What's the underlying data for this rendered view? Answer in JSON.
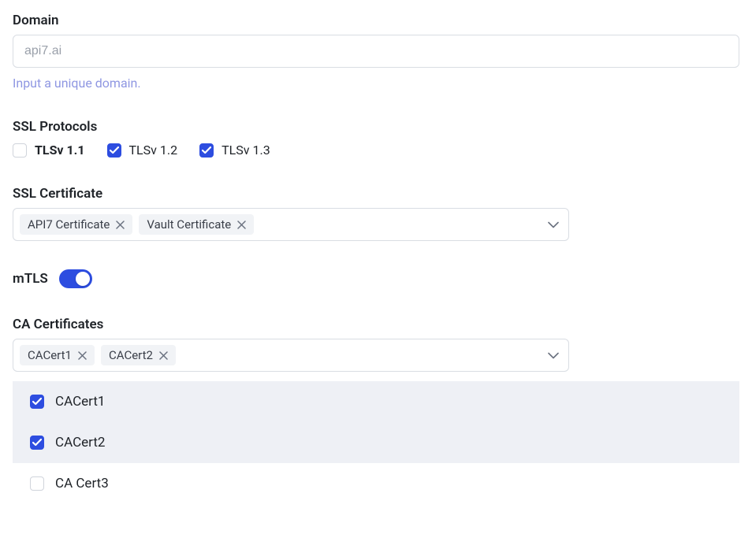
{
  "domain": {
    "label": "Domain",
    "placeholder": "api7.ai",
    "value": "",
    "helper": "Input a unique domain."
  },
  "ssl_protocols": {
    "label": "SSL Protocols",
    "options": [
      {
        "label": "TLSv 1.1",
        "checked": false,
        "bold": true
      },
      {
        "label": "TLSv 1.2",
        "checked": true,
        "bold": false
      },
      {
        "label": "TLSv 1.3",
        "checked": true,
        "bold": false
      }
    ]
  },
  "ssl_certificate": {
    "label": "SSL Certificate",
    "tags": [
      {
        "label": "API7 Certificate"
      },
      {
        "label": "Vault Certificate"
      }
    ]
  },
  "mtls": {
    "label": "mTLS",
    "enabled": true
  },
  "ca_certificates": {
    "label": "CA Certificates",
    "tags": [
      {
        "label": "CACert1"
      },
      {
        "label": "CACert2"
      }
    ],
    "options": [
      {
        "label": "CACert1",
        "checked": true
      },
      {
        "label": "CACert2",
        "checked": true
      },
      {
        "label": "CA Cert3",
        "checked": false
      }
    ]
  }
}
